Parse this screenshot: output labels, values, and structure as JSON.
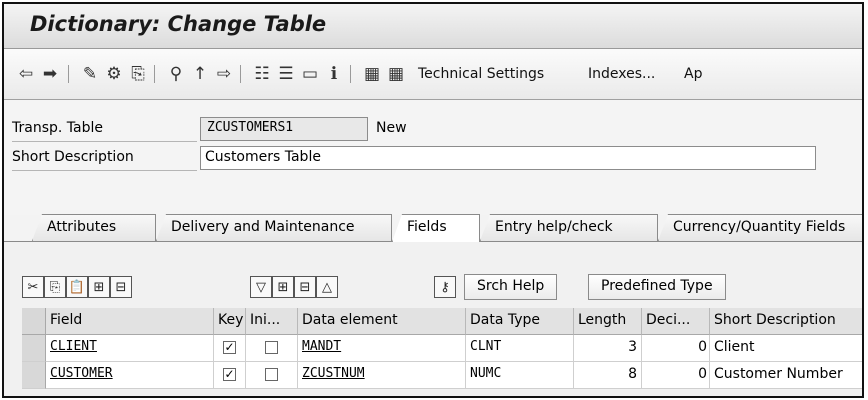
{
  "window": {
    "title": "Dictionary: Change Table"
  },
  "toolbar": {
    "icons": [
      {
        "name": "back-arrow-icon",
        "glyph": "⇦"
      },
      {
        "name": "forward-arrow-icon",
        "glyph": "➡"
      },
      {
        "name": "check-icon",
        "glyph": "✎"
      },
      {
        "name": "activate-icon",
        "glyph": "⚙"
      },
      {
        "name": "where-used-icon",
        "glyph": "⎘"
      },
      {
        "name": "hierarchy-icon",
        "glyph": "⚲"
      },
      {
        "name": "pin-icon",
        "glyph": "↑"
      },
      {
        "name": "navigate-icon",
        "glyph": "⇨"
      },
      {
        "name": "structure-icon",
        "glyph": "☷"
      },
      {
        "name": "stack-icon",
        "glyph": "☰"
      },
      {
        "name": "display-icon",
        "glyph": "▭"
      },
      {
        "name": "info-icon",
        "glyph": "ℹ"
      },
      {
        "name": "object-list-icon",
        "glyph": "▦"
      },
      {
        "name": "grid-icon",
        "glyph": "▦"
      }
    ],
    "technical_settings": "Technical Settings",
    "indexes": "Indexes...",
    "append": "Ap"
  },
  "form": {
    "transp_table_label": "Transp. Table",
    "transp_table_value": "ZCUSTOMERS1",
    "status": "New",
    "short_description_label": "Short Description",
    "short_description_value": "Customers Table"
  },
  "tabs": [
    {
      "label": "Attributes",
      "active": false
    },
    {
      "label": "Delivery and Maintenance",
      "active": false
    },
    {
      "label": "Fields",
      "active": true
    },
    {
      "label": "Entry help/check",
      "active": false
    },
    {
      "label": "Currency/Quantity Fields",
      "active": false
    }
  ],
  "field_toolbar": {
    "icon_buttons": [
      {
        "name": "cut-icon",
        "glyph": "✂"
      },
      {
        "name": "copy-icon",
        "glyph": "⎘"
      },
      {
        "name": "paste-icon",
        "glyph": "📋"
      },
      {
        "name": "insert-row-icon",
        "glyph": "⊞"
      },
      {
        "name": "delete-row-icon",
        "glyph": "⊟"
      },
      {
        "name": "filter-icon",
        "glyph": "▽"
      },
      {
        "name": "expand-icon",
        "glyph": "⊞"
      },
      {
        "name": "collapse-icon",
        "glyph": "⊟"
      },
      {
        "name": "sort-icon",
        "glyph": "△"
      },
      {
        "name": "key-icon",
        "glyph": "⚷"
      }
    ],
    "srch_help": "Srch Help",
    "predefined_type": "Predefined Type"
  },
  "table": {
    "columns": [
      "Field",
      "Key",
      "Ini...",
      "Data element",
      "Data Type",
      "Length",
      "Deci...",
      "Short Description"
    ],
    "rows": [
      {
        "field": "CLIENT",
        "key": true,
        "initial": false,
        "data_element": "MANDT",
        "data_type": "CLNT",
        "length": "3",
        "decimals": "0",
        "short_description": "Client"
      },
      {
        "field": "CUSTOMER",
        "key": true,
        "initial": false,
        "data_element": "ZCUSTNUM",
        "data_type": "NUMC",
        "length": "8",
        "decimals": "0",
        "short_description": "Customer Number"
      }
    ]
  }
}
